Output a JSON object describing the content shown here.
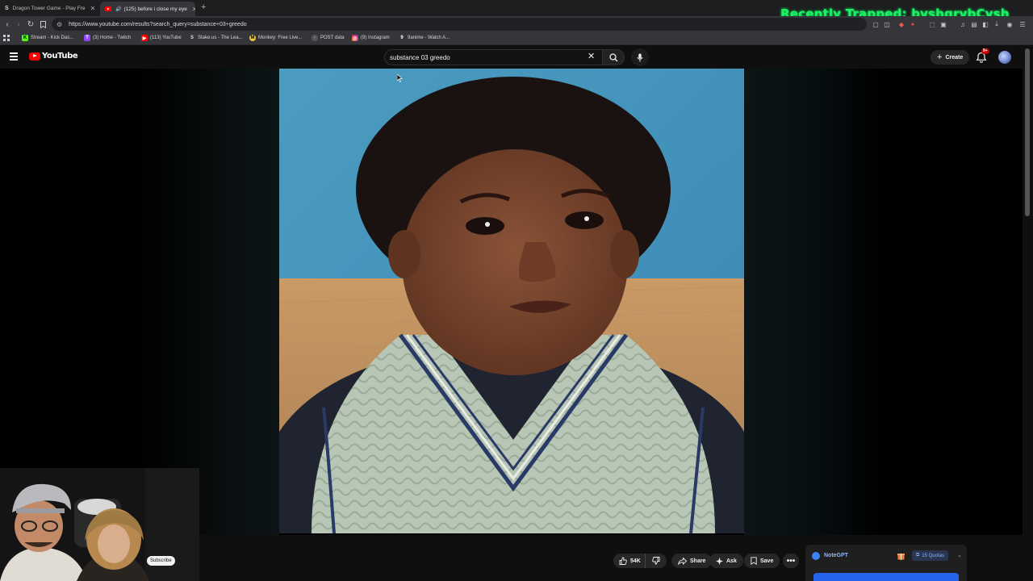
{
  "browser": {
    "tabs": [
      {
        "label": "Dragon Tower Game - Play Fre",
        "favicon": "S",
        "active": false
      },
      {
        "label": "(125) before i close my eye",
        "favicon": "youtube-icon",
        "active": true
      }
    ],
    "url": "https://www.youtube.com/results?search_query=substance+03+greedo",
    "bookmarks": [
      {
        "label": "Stream - Kick Das...",
        "icon": "K",
        "color": "#53fc18"
      },
      {
        "label": "(3) Home - Twitch",
        "icon": "T",
        "color": "#9146ff"
      },
      {
        "label": "(113) YouTube",
        "icon": "Y",
        "color": "#ff0000"
      },
      {
        "label": "Stake.us - The Lea...",
        "icon": "S",
        "color": "#2f4553"
      },
      {
        "label": "Monkey: Free Live...",
        "icon": "M",
        "color": "#f5c542"
      },
      {
        "label": "POST data",
        "icon": "P",
        "color": "#555555"
      },
      {
        "label": "(9) Instagram",
        "icon": "I",
        "color": "#e1306c"
      },
      {
        "label": "9anime - Watch A...",
        "icon": "9",
        "color": "#333333"
      }
    ]
  },
  "overlay": {
    "recently_trapped": "Recently Trapped: bvshgrvbCvsh"
  },
  "youtube": {
    "logo_text": "YouTube",
    "search_value": "substance 03 greedo",
    "create_label": "Create",
    "notification_badge": "9+"
  },
  "actions": {
    "like_count": "54K",
    "share_label": "Share",
    "ask_label": "Ask",
    "save_label": "Save"
  },
  "notegpt": {
    "name": "NoteGPT",
    "quota": "15 Quotas"
  },
  "webcam": {
    "subscribe_label": "Subscribe"
  },
  "colors": {
    "youtube_red": "#ff0000",
    "overlay_green": "#22ee66",
    "notegpt_blue": "#3b82f6",
    "page_bg": "#0f0f0f"
  }
}
